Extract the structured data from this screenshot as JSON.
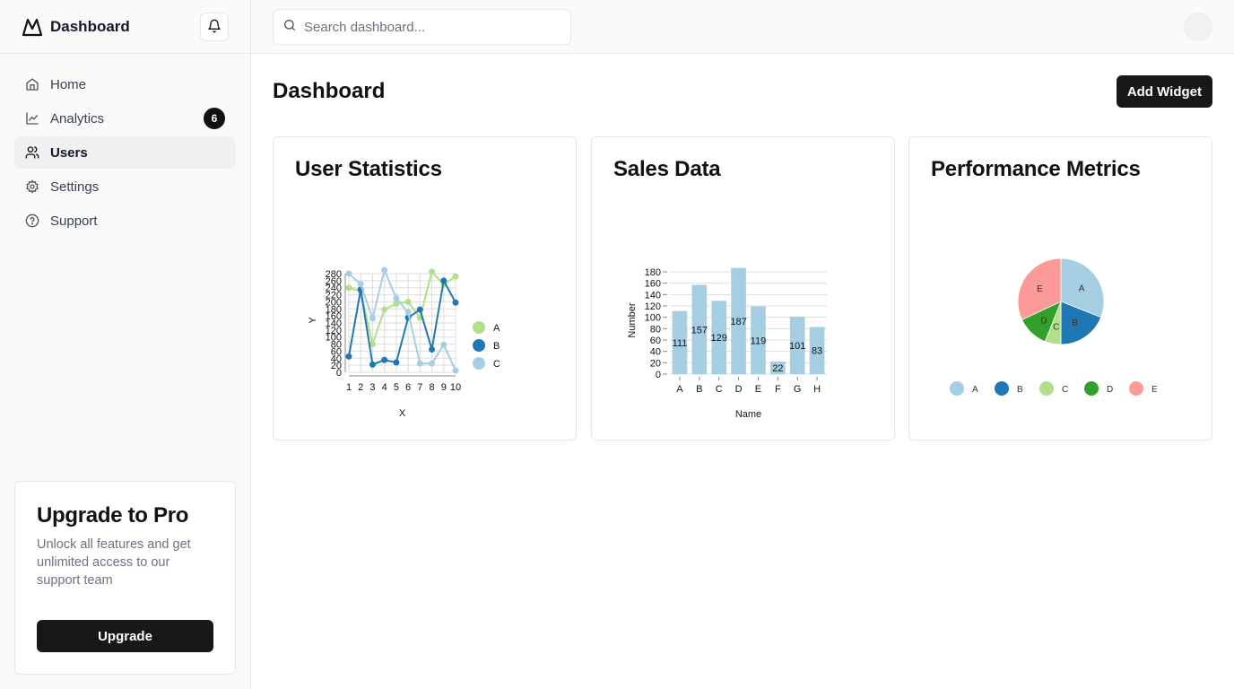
{
  "brand": {
    "title": "Dashboard"
  },
  "sidebar": {
    "items": [
      {
        "label": "Home",
        "icon": "home-icon"
      },
      {
        "label": "Analytics",
        "icon": "chart-line-icon",
        "badge": "6"
      },
      {
        "label": "Users",
        "icon": "users-icon",
        "active": true
      },
      {
        "label": "Settings",
        "icon": "gear-icon"
      },
      {
        "label": "Support",
        "icon": "help-circle-icon"
      }
    ],
    "upgrade": {
      "title": "Upgrade to Pro",
      "text": "Unlock all features and get unlimited access to our support team",
      "button": "Upgrade"
    }
  },
  "topbar": {
    "search_placeholder": "Search dashboard..."
  },
  "main": {
    "title": "Dashboard",
    "add_widget": "Add Widget",
    "cards": [
      {
        "title": "User Statistics"
      },
      {
        "title": "Sales Data"
      },
      {
        "title": "Performance Metrics"
      }
    ]
  },
  "colors": {
    "lightblue": "#a6cee3",
    "darkblue": "#1f78b4",
    "lightgreen": "#b2df8a",
    "green": "#33a02c",
    "pink": "#fb9a99"
  },
  "chart_data": [
    {
      "type": "line",
      "xlabel": "X",
      "ylabel": "Y",
      "x": [
        1,
        2,
        3,
        4,
        5,
        6,
        7,
        8,
        9,
        10
      ],
      "ylim": [
        0,
        280
      ],
      "yticks": [
        0,
        20,
        40,
        60,
        80,
        100,
        120,
        140,
        160,
        180,
        200,
        220,
        240,
        260,
        280
      ],
      "grid": true,
      "legend": "right",
      "series": [
        {
          "name": "A",
          "color": "#b2df8a",
          "values": [
            240,
            230,
            80,
            178,
            195,
            200,
            155,
            285,
            250,
            272
          ]
        },
        {
          "name": "B",
          "color": "#1f78b4",
          "values": [
            45,
            235,
            22,
            35,
            28,
            155,
            178,
            65,
            260,
            198
          ]
        },
        {
          "name": "C",
          "color": "#a6cee3",
          "values": [
            280,
            250,
            153,
            290,
            210,
            170,
            25,
            25,
            78,
            5
          ]
        }
      ]
    },
    {
      "type": "bar",
      "xlabel": "Name",
      "ylabel": "Number",
      "categories": [
        "A",
        "B",
        "C",
        "D",
        "E",
        "F",
        "G",
        "H"
      ],
      "values": [
        111,
        157,
        129,
        187,
        119,
        22,
        101,
        83
      ],
      "ylim": [
        0,
        180
      ],
      "yticks": [
        0,
        20,
        40,
        60,
        80,
        100,
        120,
        140,
        160,
        180
      ],
      "color": "#a6cee3",
      "grid": true
    },
    {
      "type": "pie",
      "categories": [
        "A",
        "B",
        "C",
        "D",
        "E"
      ],
      "values": [
        31,
        19,
        6,
        12,
        32
      ],
      "colors": [
        "#a6cee3",
        "#1f78b4",
        "#b2df8a",
        "#33a02c",
        "#fb9a99"
      ],
      "legend": "bottom"
    }
  ]
}
